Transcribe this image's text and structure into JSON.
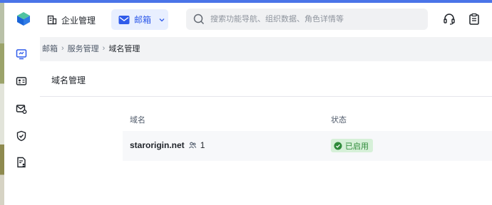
{
  "colors": {
    "accent": "#2f5bea",
    "accent_bg": "#e8efff",
    "success": "#2f8a3a",
    "success_bg": "#d6f0d8",
    "top_accent": "#4a74e8"
  },
  "topbar": {
    "enterprise_label": "企业管理",
    "enterprise_icon": "building-icon",
    "product_label": "邮箱",
    "product_icon": "mail-icon",
    "search_placeholder": "搜索功能导航、组织数据、角色详情等",
    "right_icons": [
      "headset-icon",
      "clipboard-icon"
    ]
  },
  "sidebar": {
    "items": [
      {
        "icon": "dashboard-icon",
        "active": true
      },
      {
        "icon": "contact-card-icon",
        "active": false
      },
      {
        "icon": "mail-settings-icon",
        "active": false
      },
      {
        "icon": "shield-check-icon",
        "active": false
      },
      {
        "icon": "document-user-icon",
        "active": false
      }
    ]
  },
  "breadcrumb": {
    "items": [
      "邮箱",
      "服务管理",
      "域名管理"
    ]
  },
  "page": {
    "title": "域名管理"
  },
  "table": {
    "columns": [
      "域名",
      "状态"
    ],
    "rows": [
      {
        "domain": "starorigin.net",
        "member_count": "1",
        "status": "已启用"
      }
    ]
  }
}
